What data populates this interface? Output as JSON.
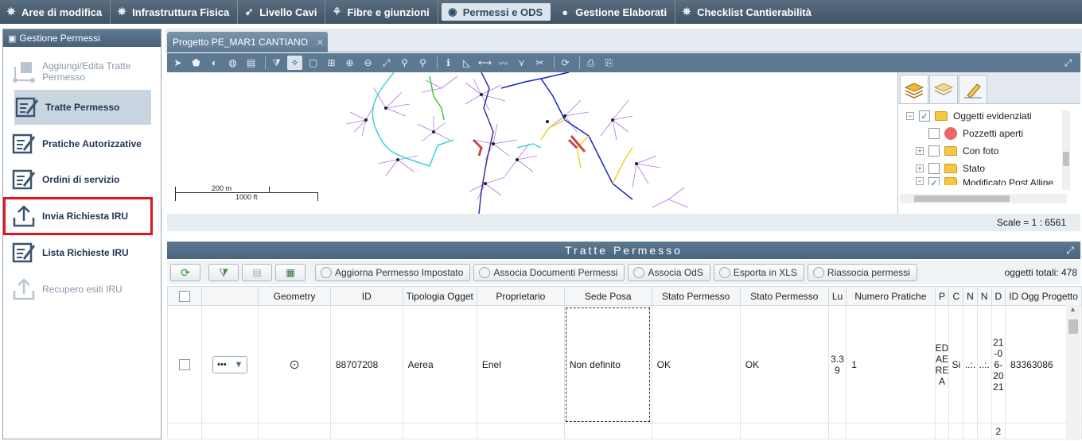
{
  "topnav": {
    "items": [
      {
        "label": "Aree di modifica",
        "icon": "star-icon"
      },
      {
        "label": "Infrastruttura Fisica",
        "icon": "star-icon"
      },
      {
        "label": "Livello Cavi",
        "icon": "cable-icon"
      },
      {
        "label": "Fibre e giunzioni",
        "icon": "fiber-icon"
      },
      {
        "label": "Permessi e ODS",
        "icon": "permit-icon",
        "active": true
      },
      {
        "label": "Gestione Elaborati",
        "icon": "circle-icon"
      },
      {
        "label": "Checklist Cantierabilità",
        "icon": "star-icon"
      }
    ]
  },
  "leftpanel": {
    "title": "Gestione Permessi",
    "items": [
      {
        "label": "Aggiungi/Edita Tratte Permesso",
        "state": "disabled"
      },
      {
        "label": "Tratte Permesso",
        "state": "selected"
      },
      {
        "label": "Pratiche Autorizzative",
        "state": "normal"
      },
      {
        "label": "Ordini di servizio",
        "state": "normal"
      },
      {
        "label": "Invia Richiesta IRU",
        "state": "highlight"
      },
      {
        "label": "Lista Richieste IRU",
        "state": "normal"
      },
      {
        "label": "Recupero esiti IRU",
        "state": "disabled"
      }
    ]
  },
  "map": {
    "tab_label": "Progetto PE_MAR1 CANTIANO",
    "tab_close": "✕",
    "scale_m": "200 m",
    "scale_ft": "1000 ft",
    "scale_text": "Scale = 1 : 6561"
  },
  "layers": {
    "items": [
      {
        "label": "Oggetti evidenziati",
        "checked": true,
        "expander": "−"
      },
      {
        "label": "Pozzetti aperti",
        "checked": false
      },
      {
        "label": "Con foto",
        "checked": false,
        "expander": "+"
      },
      {
        "label": "Stato",
        "checked": false,
        "expander": "+"
      },
      {
        "label": "Modificato Post Alline",
        "checked": true,
        "expander": "−"
      }
    ]
  },
  "grid": {
    "title": "Tratte Permesso",
    "buttons": [
      "Aggiorna Permesso Impostato",
      "Associa Documenti Permessi",
      "Associa OdS",
      "Esporta in XLS",
      "Riassocia permessi"
    ],
    "total_label": "oggetti totali: 478",
    "columns": [
      "Geometry",
      "ID",
      "Tipologia Ogget",
      "Proprietario",
      "Sede Posa",
      "Stato Permesso",
      "Stato Permesso",
      "Lu",
      "Numero Pratiche",
      "P",
      "C",
      "N",
      "N",
      "D",
      "ID Ogg Progetto"
    ],
    "row": {
      "actions": "•••",
      "id": "88707208",
      "tipologia": "Aerea",
      "proprietario": "Enel",
      "sede_posa": "Non definito",
      "stato1": "OK",
      "stato2": "OK",
      "lu": "3.39",
      "numero_pratiche": "1",
      "p": "EDAEREA",
      "c": "Si",
      "n1": "..:.",
      "n2": "..:.",
      "d": "21-06-2021",
      "id_ogg": "83363086"
    },
    "row2_d": "2"
  }
}
